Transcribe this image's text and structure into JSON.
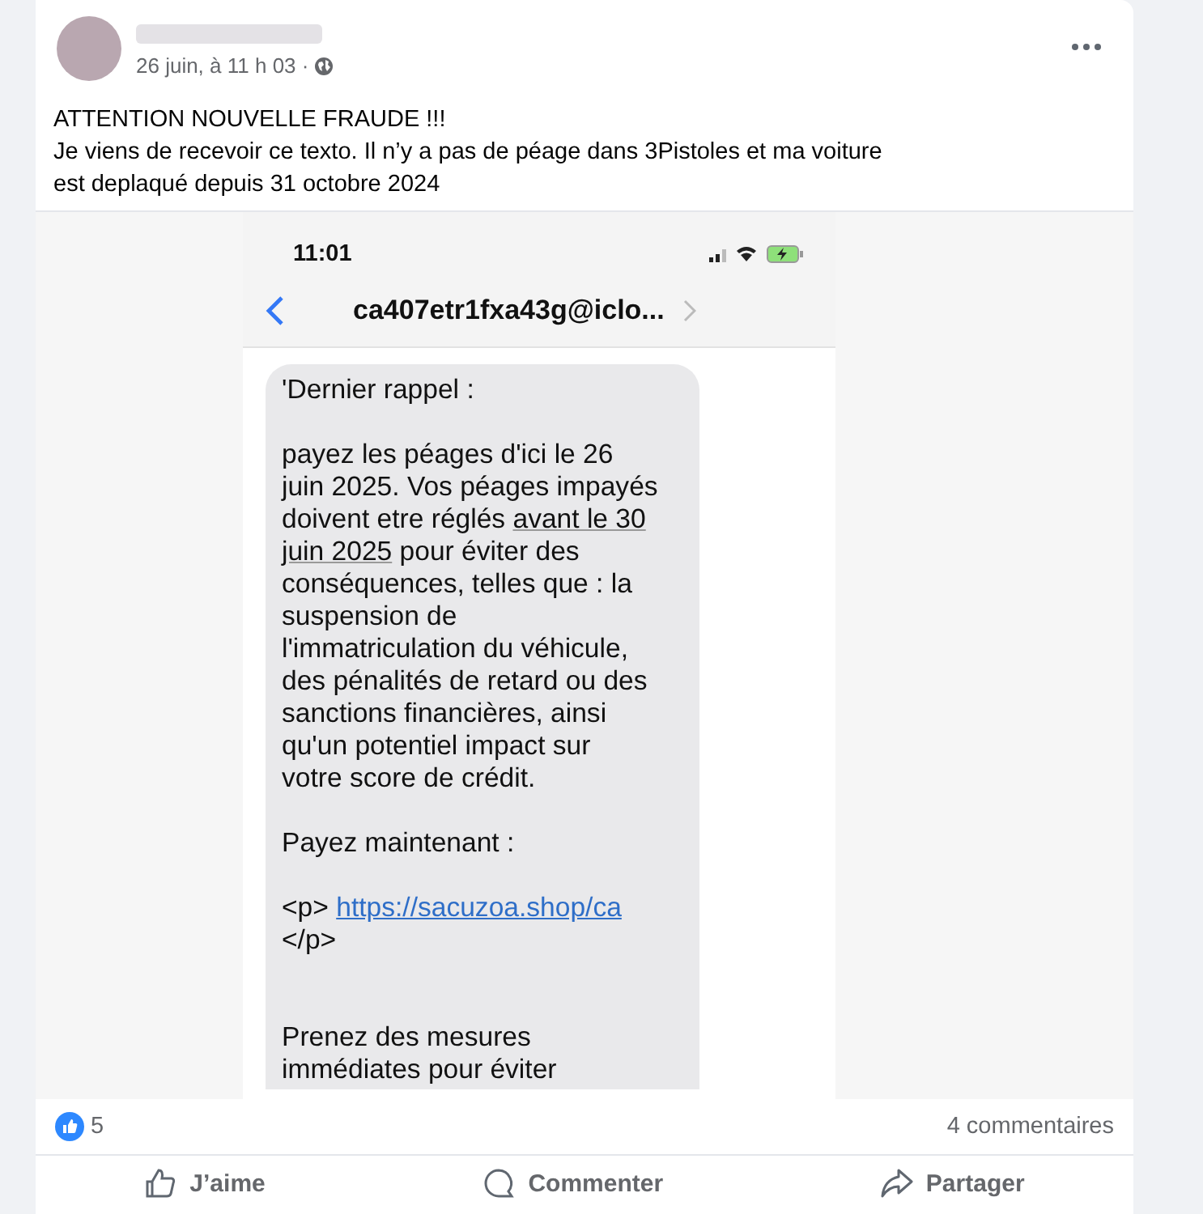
{
  "post": {
    "timestamp": "26 juin, à 11 h 03 ·",
    "text": "ATTENTION NOUVELLE FRAUDE !!!\nJe viens de recevoir ce texto. Il n’y a pas de péage dans 3Pistoles et ma voiture\nest deplaqué depuis 31 octobre 2024"
  },
  "phone": {
    "time": "11:01",
    "contact": "ca407etr1fxa43g@iclo...",
    "message": [
      [
        {
          "kind": "text",
          "text": "'Dernier rappel :"
        }
      ],
      [
        {
          "kind": "text",
          "text": "payez les péages d'ici le 26\njuin 2025. Vos péages impayés\ndoivent etre réglés "
        },
        {
          "kind": "underline",
          "text": "avant le 30\njuin 2025"
        },
        {
          "kind": "text",
          "text": " pour éviter des\nconséquences, telles que : la\nsuspension de\nl'immatriculation du véhicule,\ndes pénalités de retard ou des\nsanctions financières, ainsi\nqu'un potentiel impact sur\nvotre score de crédit."
        }
      ],
      [
        {
          "kind": "text",
          "text": " Payez maintenant :"
        }
      ],
      [
        {
          "kind": "text",
          "text": " <p> "
        },
        {
          "kind": "link",
          "text": "https://sacuzoa.shop/ca"
        },
        {
          "kind": "text",
          "text": "\n</p>"
        }
      ],
      [
        {
          "kind": "text",
          "text": "\n Prenez des mesures\n immédiates pour éviter"
        }
      ]
    ]
  },
  "reactions": {
    "count": "5",
    "comments": "4 commentaires"
  },
  "actions": [
    {
      "kind": "like",
      "label": "J’aime"
    },
    {
      "kind": "comment",
      "label": "Commenter"
    },
    {
      "kind": "share",
      "label": "Partager"
    }
  ]
}
